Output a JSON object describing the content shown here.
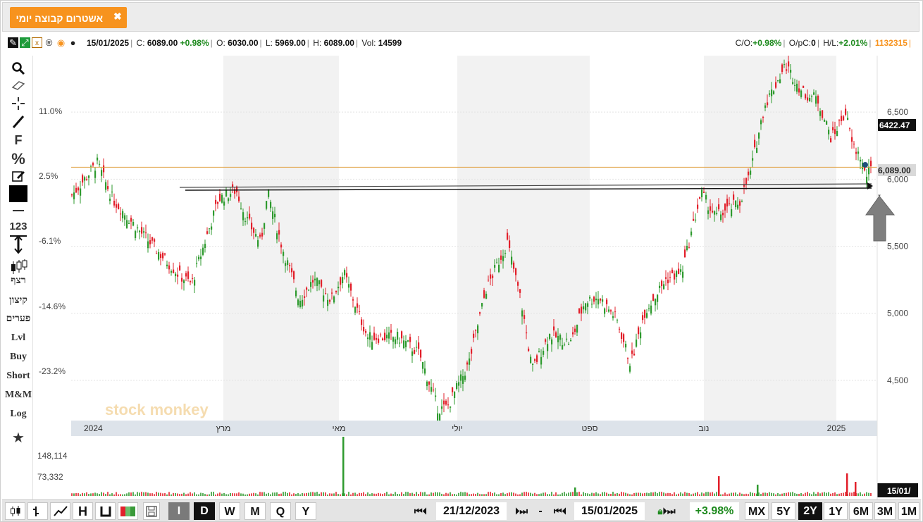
{
  "tab": {
    "title": "אשטרום קבוצה יומי",
    "close": "✖"
  },
  "info": {
    "date": "15/01/2025",
    "close_label": "C:",
    "close": "6089.00",
    "change": "+0.98%",
    "open_label": "O:",
    "open": "6030.00",
    "low_label": "L:",
    "low": "5969.00",
    "high_label": "H:",
    "high": "6089.00",
    "vol_label": "Vol:",
    "vol": "14599",
    "co_label": "C/O:",
    "co": "+0.98%",
    "opc_label": "O/pC:",
    "opc": "0",
    "hl_label": "H/L:",
    "hl": "+2.01%",
    "security_id": "1132315"
  },
  "tools": [
    "search-icon",
    "eraser-icon",
    "crosshair-icon",
    "trendline-icon",
    "F",
    "%",
    "edit-icon",
    "color-swatch",
    "line-width-icon",
    "123",
    "vertical-measure-icon",
    "candles-icon",
    "רצף",
    "קיצון",
    "פערים",
    "Lvl",
    "Buy",
    "Short",
    "M&M",
    "Log",
    "star-icon"
  ],
  "chart_data": {
    "type": "candlestick",
    "price_axis": {
      "ticks": [
        "6,500",
        "6,000",
        "5,500",
        "5,000",
        "4,500"
      ],
      "markers": [
        "6422.47",
        "6,089.00"
      ]
    },
    "percent_axis": {
      "ticks": [
        "11.0%",
        "2.5%",
        "-6.1%",
        "-14.6%",
        "-23.2%"
      ]
    },
    "time_axis": {
      "ticks": [
        "2024",
        "מרץ",
        "מאי",
        "יולי",
        "ספט",
        "נוב",
        "2025"
      ]
    },
    "volume_axis": {
      "ticks": [
        "148,114",
        "73,332"
      ],
      "marker": "15/01/"
    },
    "watermark": "stock monkey",
    "ylim": [
      4200,
      6900
    ],
    "reference_line": 6089,
    "support_line": [
      5950,
      5980
    ],
    "colors": {
      "up": "#2e9a2e",
      "down": "#e2202b",
      "reference": "#e0a040",
      "line": "#111111"
    }
  },
  "bottom": {
    "styles": [
      "candles-icon",
      "ohlc-icon",
      "line-icon",
      "H",
      "heikin-icon",
      "bars-icon",
      "save-icon"
    ],
    "intervals": [
      "I",
      "D",
      "W",
      "M",
      "Q",
      "Y"
    ],
    "from_date": "21/12/2023",
    "dash": "-",
    "to_date": "15/01/2025",
    "period_change": "+3.98%",
    "ranges": [
      "MX",
      "5Y",
      "2Y",
      "1Y",
      "6M",
      "3M",
      "1M"
    ]
  }
}
